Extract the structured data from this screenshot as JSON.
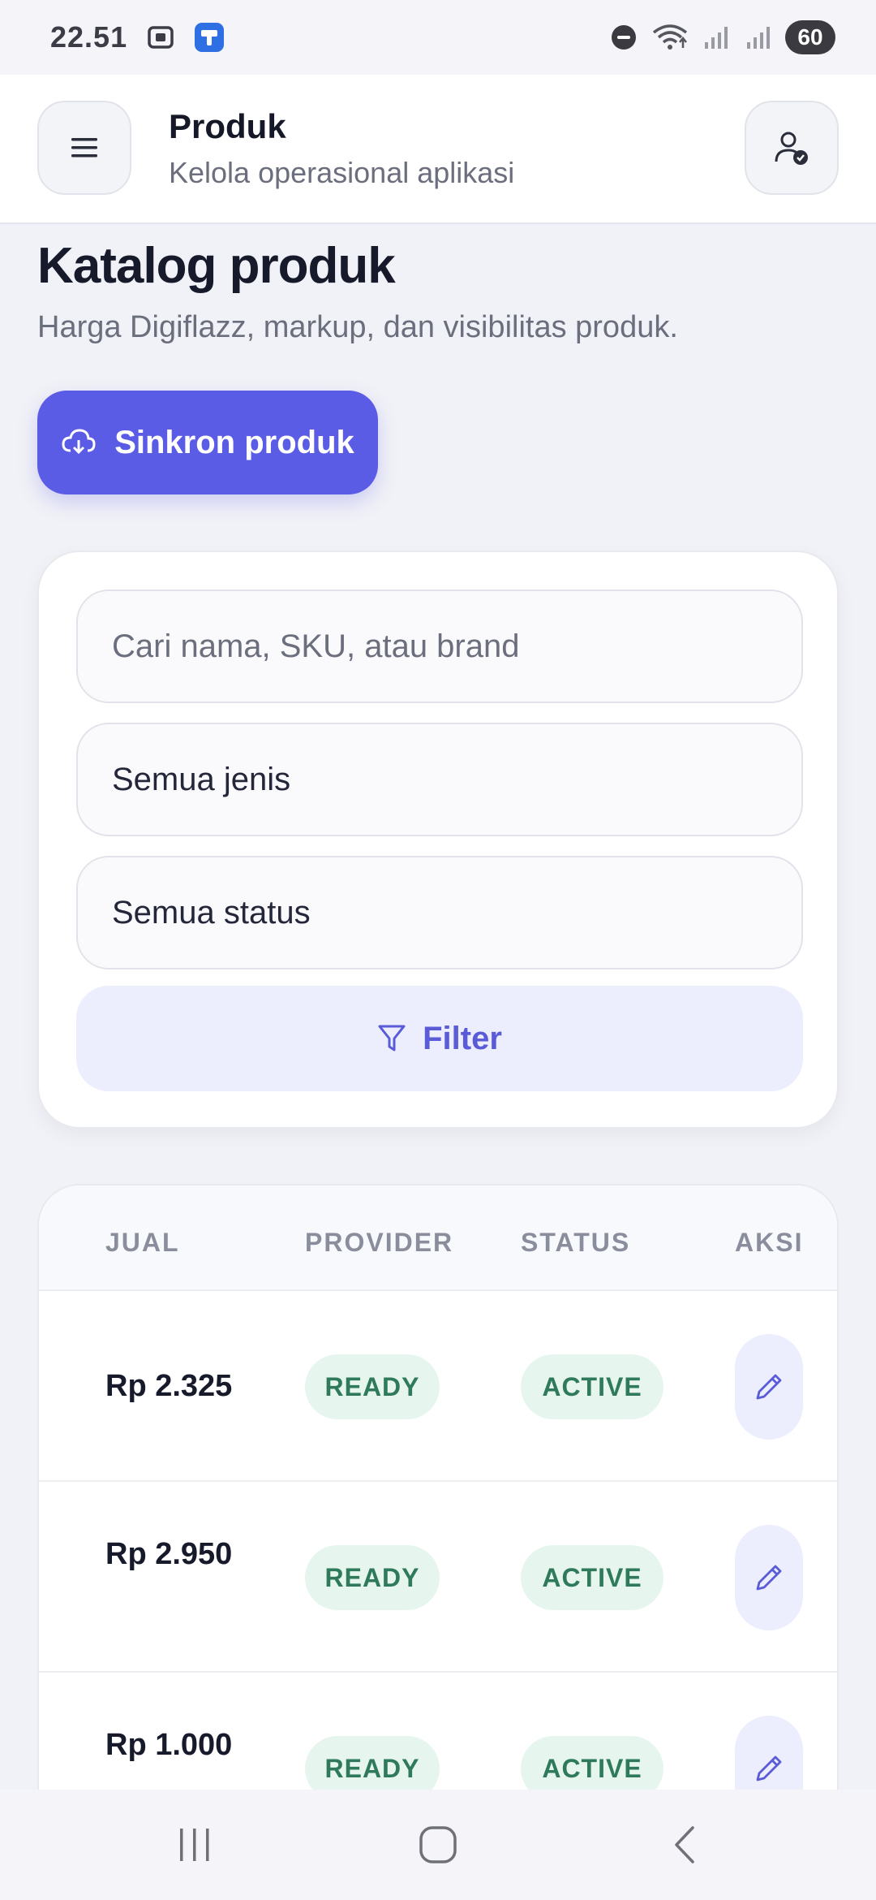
{
  "status_bar": {
    "time": "22.51",
    "battery": "60"
  },
  "header": {
    "title": "Produk",
    "subtitle": "Kelola operasional aplikasi"
  },
  "page": {
    "title": "Katalog produk",
    "description": "Harga Digiflazz, markup, dan visibilitas produk.",
    "sync_label": "Sinkron produk"
  },
  "filters": {
    "search_placeholder": "Cari nama, SKU, atau brand",
    "type_value": "Semua jenis",
    "status_value": "Semua status",
    "filter_label": "Filter"
  },
  "table": {
    "columns": [
      "JUAL",
      "PROVIDER",
      "STATUS",
      "AKSI"
    ],
    "rows": [
      {
        "price": "Rp 2.325",
        "provider": "READY",
        "status": "ACTIVE"
      },
      {
        "price": "Rp 2.950",
        "provider": "READY",
        "status": "ACTIVE"
      },
      {
        "price": "Rp 1.000",
        "provider": "READY",
        "status": "ACTIVE"
      }
    ]
  },
  "icons": {
    "menu": "hamburger-icon",
    "profile": "user-check-icon",
    "sync": "cloud-download-icon",
    "filter": "funnel-icon",
    "edit": "pencil-icon"
  },
  "colors": {
    "accent": "#5b5ce6",
    "badge_bg": "#e6f6ef",
    "badge_text": "#2f7a5a"
  }
}
